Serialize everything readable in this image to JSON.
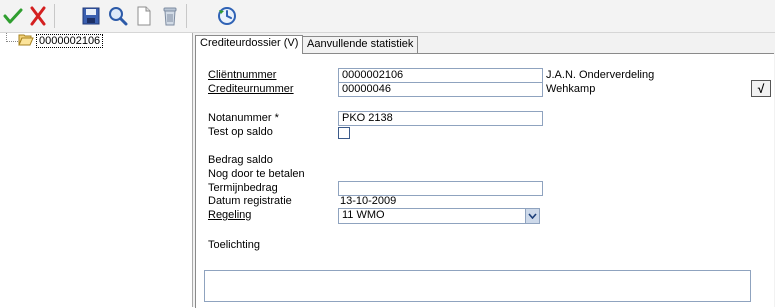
{
  "toolbar": {
    "icons": [
      "confirm-check-icon",
      "cancel-x-icon",
      "save-disk-icon",
      "search-magnifier-icon",
      "new-document-icon",
      "delete-trash-icon",
      "refresh-clock-icon"
    ],
    "colors": {
      "check": "#2f9e2f",
      "x": "#d42020",
      "disk": "#3a5fb0"
    }
  },
  "tree": {
    "node_label": "0000002106"
  },
  "tabs": [
    {
      "label": "Crediteurdossier (V)",
      "active": true
    },
    {
      "label": "Aanvullende statistiek",
      "active": false
    }
  ],
  "form": {
    "clientnummer_label": "Cliëntnummer",
    "clientnummer_value": "0000002106",
    "clientnummer_side": "J.A.N. Onderverdeling",
    "crediteurnummer_label": "Crediteurnummer",
    "crediteurnummer_value": "00000046",
    "crediteurnummer_side": "Wehkamp",
    "notanummer_label": "Notanummer *",
    "notanummer_value": "PKO 2138",
    "test_saldo_label": "Test op saldo",
    "bedrag_saldo_label": "Bedrag saldo",
    "nog_betalen_label": "Nog door te betalen",
    "termijnbedrag_label": "Termijnbedrag",
    "termijnbedrag_value": "",
    "datum_registratie_label": "Datum registratie",
    "datum_registratie_value": "13-10-2009",
    "regeling_label": "Regeling",
    "regeling_value": "11 WMO",
    "toelichting_label": "Toelichting",
    "toelichting_value": "",
    "confirm_button": "√"
  }
}
